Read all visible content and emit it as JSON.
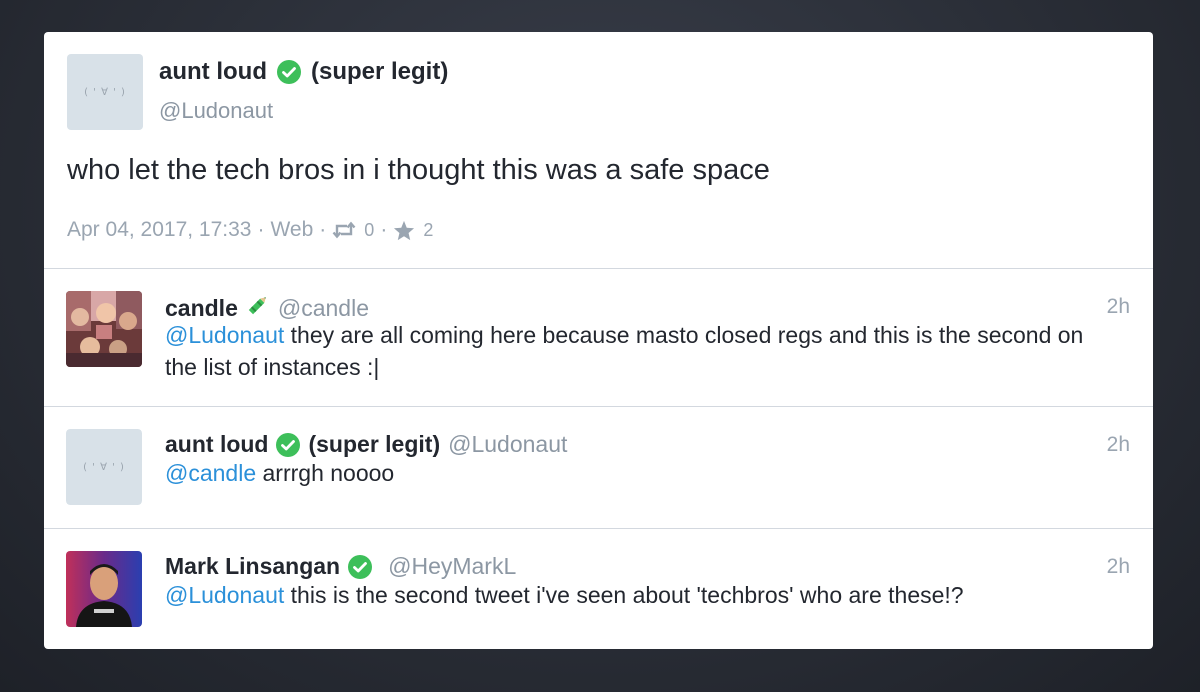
{
  "status": {
    "author_name": "aunt loud",
    "author_suffix": "(super legit)",
    "author_handle": "@Ludonaut",
    "avatar_text": "( ' ∀ ' )",
    "text": "who let the tech bros in i thought this was a safe space",
    "date": "Apr 04, 2017, 17:33",
    "source": "Web",
    "reblogs": "0",
    "favourites": "2",
    "separator": "·"
  },
  "replies": [
    {
      "name": "candle",
      "handle": "@candle",
      "time": "2h",
      "mention": "@Ludonaut",
      "text": " they are all coming here because masto closed regs and this is the second on the list of instances :|",
      "icon": "crayon-icon"
    },
    {
      "name": "aunt loud",
      "suffix": "(super legit)",
      "handle": "@Ludonaut",
      "time": "2h",
      "mention": "@candle",
      "text": " arrrgh noooo",
      "avatar_text": "( ' ∀ ' )",
      "icon": "verified-check-icon"
    },
    {
      "name": "Mark Linsangan",
      "handle": "@HeyMarkL",
      "time": "2h",
      "mention": "@Ludonaut",
      "text": " this is the second tweet i've seen about 'techbros' who are these!?",
      "icon": "verified-check-icon"
    }
  ],
  "colors": {
    "verified": "#3dbf5a",
    "mention": "#2b90d9",
    "muted": "#9aa5b1"
  }
}
